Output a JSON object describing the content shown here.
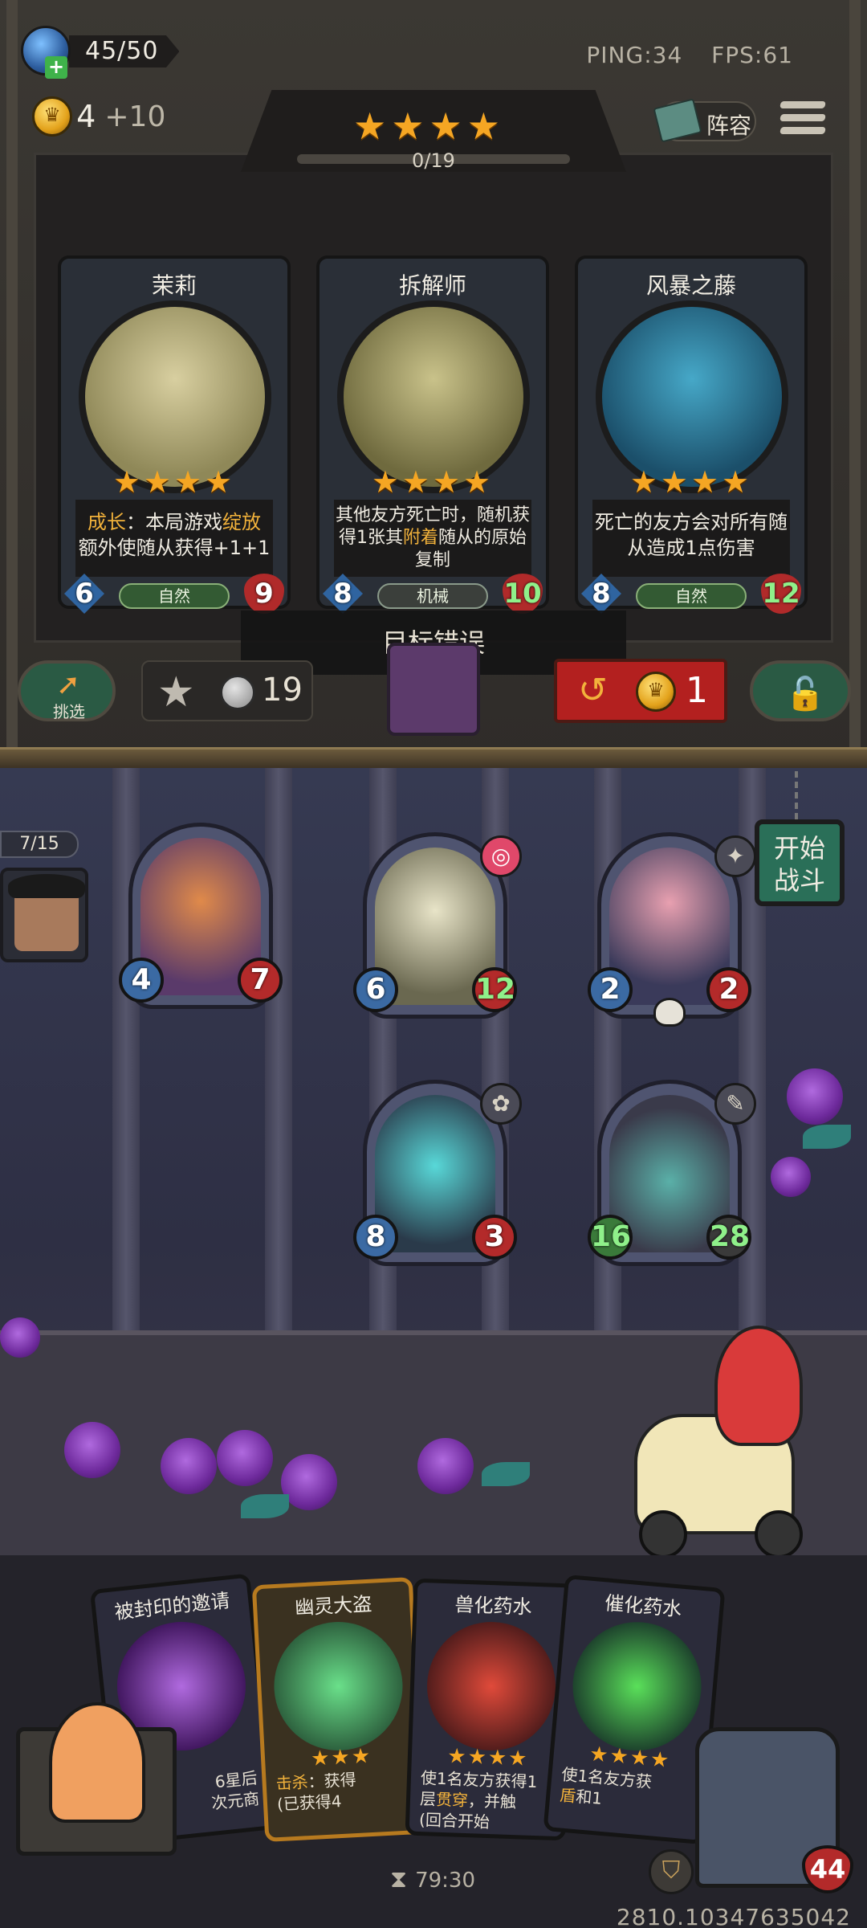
{
  "header": {
    "mana": "45/50",
    "gold": "4",
    "gold_income": "+10",
    "ping": "PING:34",
    "fps": "FPS:61",
    "lineup_label": "阵容",
    "tier_stars": "★★★★",
    "tier_progress": "0/19",
    "tier_progress_fraction": 0.0
  },
  "shop": {
    "cards": [
      {
        "name": "茉莉",
        "stars": "★★★★",
        "desc_hl1": "成长",
        "desc_a": "：本局游戏",
        "desc_hl2": "绽放",
        "desc_b": "额外使随从获得+1+1",
        "tribe": "自然",
        "attack": "6",
        "health": "9",
        "art_colors": [
          "#d8cfa0",
          "#8f8858"
        ]
      },
      {
        "name": "拆解师",
        "stars": "★★★★",
        "desc_a": "其他友方死亡时，随机获得1张其",
        "desc_hl1": "附着",
        "desc_b": "随从的原始复制",
        "tribe": "机械",
        "attack": "8",
        "health": "10",
        "art_colors": [
          "#c9c28a",
          "#6f6a3e"
        ]
      },
      {
        "name": "风暴之藤",
        "stars": "★★★★",
        "desc_a": "死亡的友方会对所有随从造成1点伤害",
        "tribe": "自然",
        "attack": "8",
        "health": "12",
        "art_colors": [
          "#46a8c8",
          "#1b4f6a"
        ]
      }
    ],
    "toast": "目标错误"
  },
  "actions": {
    "pick_label": "挑选",
    "upgrade_cost": "19",
    "refresh_cost": "1"
  },
  "board": {
    "wave": "7/15",
    "start_label_1": "开始",
    "start_label_2": "战斗",
    "minions": [
      {
        "attack": "4",
        "health": "7",
        "badge": "",
        "art": "#8a5a3a"
      },
      {
        "attack": "6",
        "health": "12",
        "badge": "◎",
        "art": "#c9c6a8"
      },
      {
        "attack": "2",
        "health": "2",
        "badge": "✦",
        "art": "#6a5a7c"
      },
      {
        "attack": "8",
        "health": "3",
        "badge": "✿",
        "art": "#3e8c9a"
      },
      {
        "attack": "16",
        "health": "28",
        "badge": "✎",
        "art": "#4a4a5a"
      }
    ]
  },
  "hand": {
    "cards": [
      {
        "title": "被封印的邀请",
        "line1": "6星后",
        "line2": "次元商",
        "stars": "",
        "art": "#6a3a8c"
      },
      {
        "title": "幽灵大盗",
        "stars": "★★★",
        "line_hl": "击杀",
        "line1": "：获得",
        "line2": "(已获得4",
        "art": "#3a9a5a"
      },
      {
        "title": "兽化药水",
        "stars": "★★★★",
        "line1": "使1名友方获得1",
        "line_hl": "贯穿",
        "line2a": "层",
        "line2b": "，并触",
        "line3": "(回合开始",
        "art": "#b83a2a"
      },
      {
        "title": "催化药水",
        "stars": "★★★★",
        "line1": "使1名友方获",
        "line_hl": "盾",
        "line2b": "和1",
        "art": "#3aa84a"
      }
    ],
    "player_health": "44",
    "timer": "79:30",
    "build_id": "2810.10347635042"
  }
}
